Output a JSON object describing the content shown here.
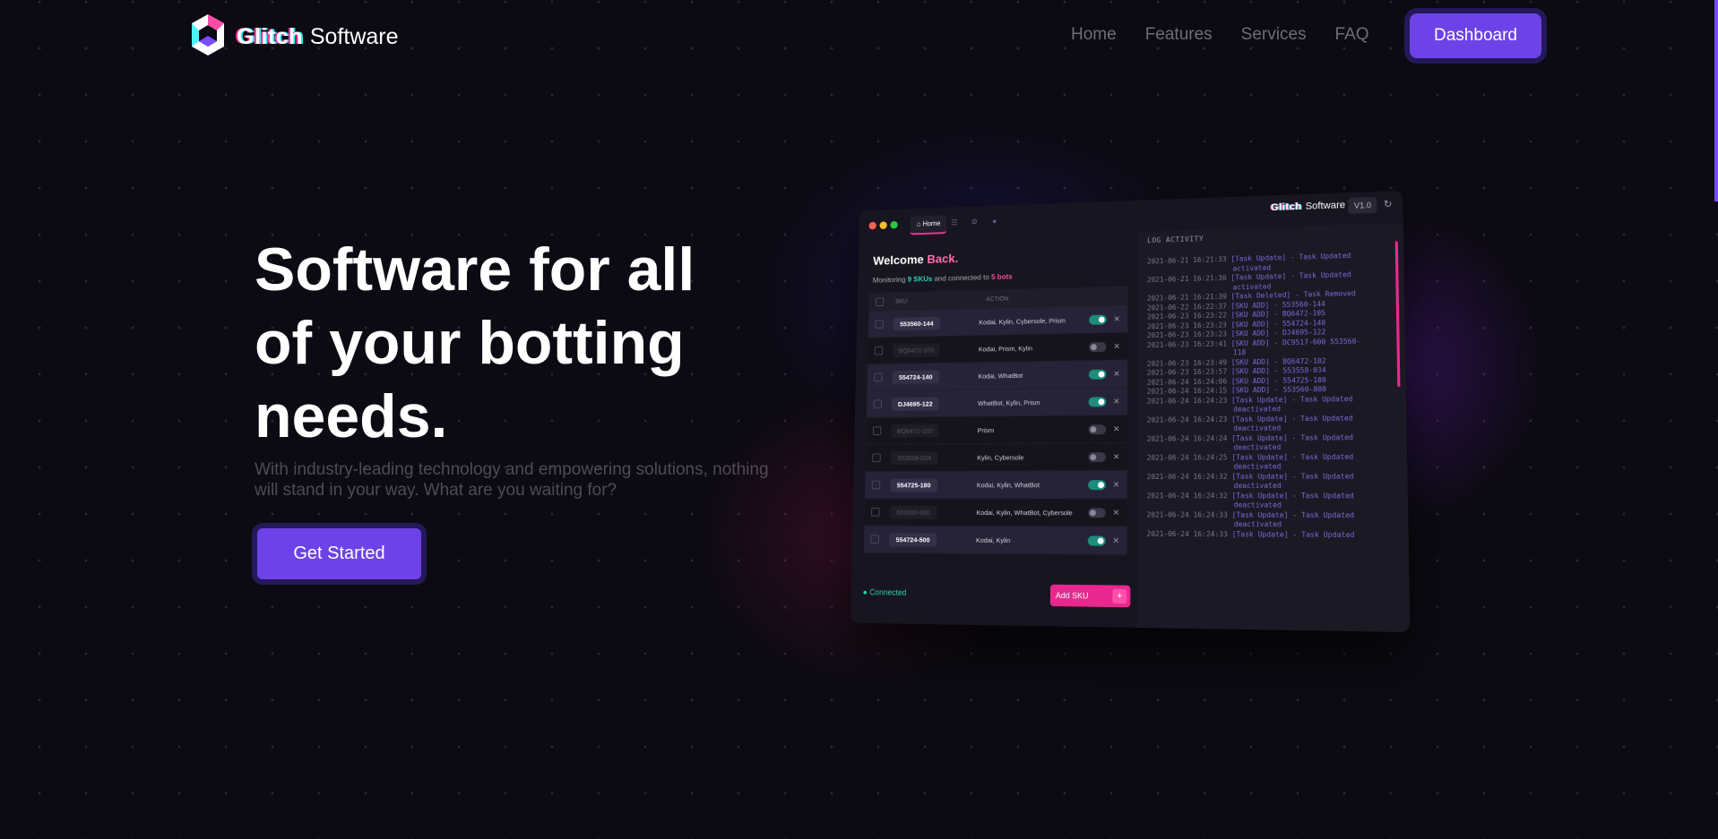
{
  "colors": {
    "accent": "#6d43e8",
    "pink": "#e8288f",
    "teal": "#28d6b4",
    "bg": "#0c0a12"
  },
  "nav": {
    "logo_icon": "cube-logo-icon",
    "brand_glitch": "Glitch",
    "brand_software": "Software",
    "links": [
      "Home",
      "Features",
      "Services",
      "FAQ"
    ],
    "dashboard_label": "Dashboard"
  },
  "hero": {
    "title": "Software for all of your botting needs.",
    "subtitle": "With industry-leading technology and empowering solutions, nothing will stand in your way. What are you waiting for?",
    "cta_label": "Get Started"
  },
  "app": {
    "tab_home": "Home",
    "brand_glitch": "Glitch",
    "brand_software": "Software",
    "version": "V1.0",
    "welcome_1": "Welcome",
    "welcome_2": "Back.",
    "monitor_pre": "Monitoring",
    "monitor_skus": "9 SKUs",
    "monitor_mid": "and connected to",
    "monitor_bots": "5 bots",
    "col_sku": "SKU",
    "col_action": "ACTION",
    "rows": [
      {
        "sku": "553560-144",
        "bots": "Kodai, Kylin, Cybersole, Prism",
        "active": true
      },
      {
        "sku": "BQ6472-105",
        "bots": "Kodai, Prism, Kylin",
        "active": false
      },
      {
        "sku": "554724-140",
        "bots": "Kodai, WhatBot",
        "active": true
      },
      {
        "sku": "DJ4695-122",
        "bots": "WhatBot, Kylin, Prism",
        "active": true
      },
      {
        "sku": "BQ6472-102",
        "bots": "Prism",
        "active": false
      },
      {
        "sku": "553558-034",
        "bots": "Kylin, Cybersole",
        "active": false
      },
      {
        "sku": "554725-180",
        "bots": "Kodai, Kylin, WhatBot",
        "active": true
      },
      {
        "sku": "553560-800",
        "bots": "Kodai, Kylin, WhatBot, Cybersole",
        "active": false
      },
      {
        "sku": "554724-500",
        "bots": "Kodai, Kylin",
        "active": true
      }
    ],
    "status": "Connected",
    "add_sku_label": "Add SKU",
    "add_sku_plus": "+",
    "log_title": "LOG ACTIVITY",
    "log": [
      [
        "2021-06-21 16:21:33",
        "[Task Update] - Task Updated",
        "activated"
      ],
      [
        "2021-06-21 16:21:36",
        "[Task Update] - Task Updated",
        "activated"
      ],
      [
        "2021-06-21 16:21:39",
        "[Task Deleted] - Task Removed"
      ],
      [
        "2021-06-22 16:22:37",
        "[SKU ADD] - 553560-144"
      ],
      [
        "2021-06-23 16:23:22",
        "[SKU ADD] - BQ6472-105"
      ],
      [
        "2021-06-23 16:23:23",
        "[SKU ADD] - 554724-140"
      ],
      [
        "2021-06-23 16:23:23",
        "[SKU ADD] - DJ4695-122"
      ],
      [
        "2021-06-23 16:23:41",
        "[SKU ADD] - DC9517-600 553560-",
        "118"
      ],
      [
        "2021-06-23 16:23:49",
        "[SKU ADD] - BQ6472-102"
      ],
      [
        "2021-06-23 16:23:57",
        "[SKU ADD] - 553558-034"
      ],
      [
        "2021-06-24 16:24:06",
        "[SKU ADD] - 554725-180"
      ],
      [
        "2021-06-24 16:24:15",
        "[SKU ADD] - 553560-800"
      ],
      [
        "2021-06-24 16:24:23",
        "[Task Update] - Task Updated",
        "deactivated"
      ],
      [
        "2021-06-24 16:24:23",
        "[Task Update] - Task Updated",
        "deactivated"
      ],
      [
        "2021-06-24 16:24:24",
        "[Task Update] - Task Updated",
        "deactivated"
      ],
      [
        "2021-06-24 16:24:25",
        "[Task Update] - Task Updated",
        "deactivated"
      ],
      [
        "2021-06-24 16:24:32",
        "[Task Update] - Task Updated",
        "deactivated"
      ],
      [
        "2021-06-24 16:24:32",
        "[Task Update] - Task Updated",
        "deactivated"
      ],
      [
        "2021-06-24 16:24:33",
        "[Task Update] - Task Updated",
        "deactivated"
      ],
      [
        "2021-06-24 16:24:33",
        "[Task Update] - Task Updated"
      ]
    ]
  }
}
